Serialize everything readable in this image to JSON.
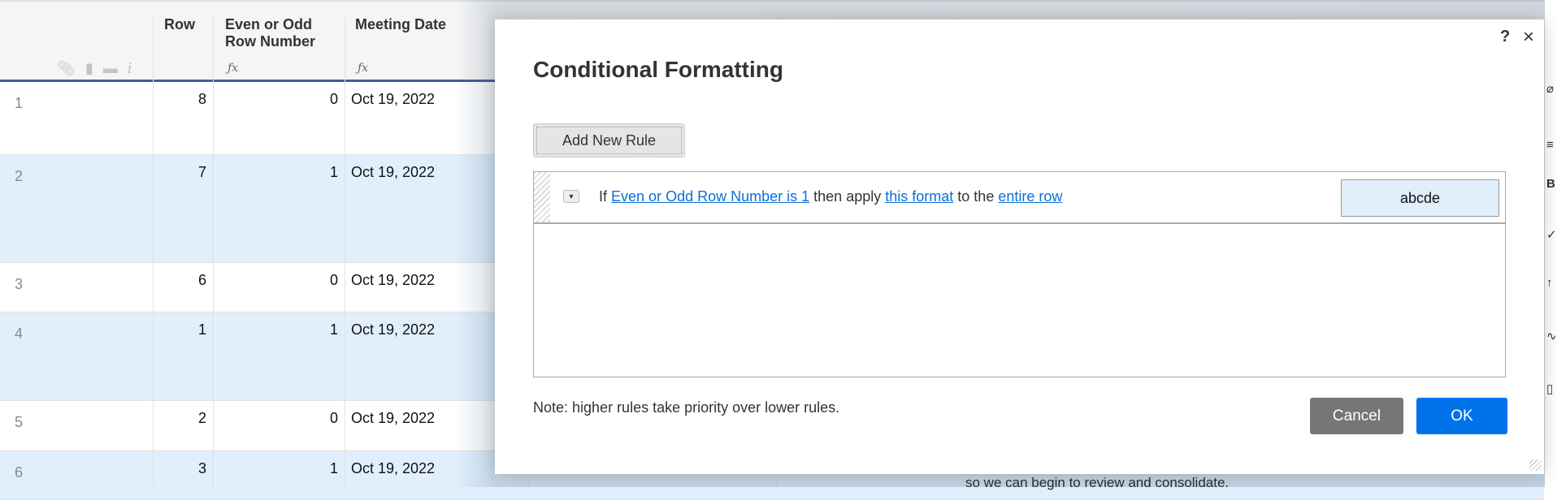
{
  "grid": {
    "columns": [
      {
        "label": "Row",
        "formula": false
      },
      {
        "label": "Even or Odd Row Number",
        "formula": true
      },
      {
        "label": "Meeting Date",
        "formula": true
      }
    ],
    "formula_icon": "ƒx",
    "header_icons": [
      "attachment-icon",
      "comment-icon",
      "proofing-icon",
      "info-icon"
    ],
    "rows": [
      {
        "num": "1",
        "row": "8",
        "even_odd": "0",
        "date": "Oct 19, 2022"
      },
      {
        "num": "2",
        "row": "7",
        "even_odd": "1",
        "date": "Oct 19, 2022"
      },
      {
        "num": "3",
        "row": "6",
        "even_odd": "0",
        "date": "Oct 19, 2022"
      },
      {
        "num": "4",
        "row": "1",
        "even_odd": "1",
        "date": "Oct 19, 2022"
      },
      {
        "num": "5",
        "row": "2",
        "even_odd": "0",
        "date": "Oct 19, 2022"
      },
      {
        "num": "6",
        "row": "3",
        "even_odd": "1",
        "date": "Oct 19, 2022"
      }
    ],
    "behind_text": "so we can begin to review and consolidate.",
    "highlight_color": "#e0effb"
  },
  "dialog": {
    "title": "Conditional Formatting",
    "help": "?",
    "close": "×",
    "add_rule": "Add New Rule",
    "rule": {
      "if": "If",
      "condition": "Even or Odd Row Number is 1",
      "then": "then apply",
      "format": "this format",
      "to": "to the",
      "target": "entire row",
      "preview": "abcde"
    },
    "note": "Note: higher rules take priority over lower rules.",
    "cancel": "Cancel",
    "ok": "OK",
    "ok_color": "#0073ea"
  }
}
